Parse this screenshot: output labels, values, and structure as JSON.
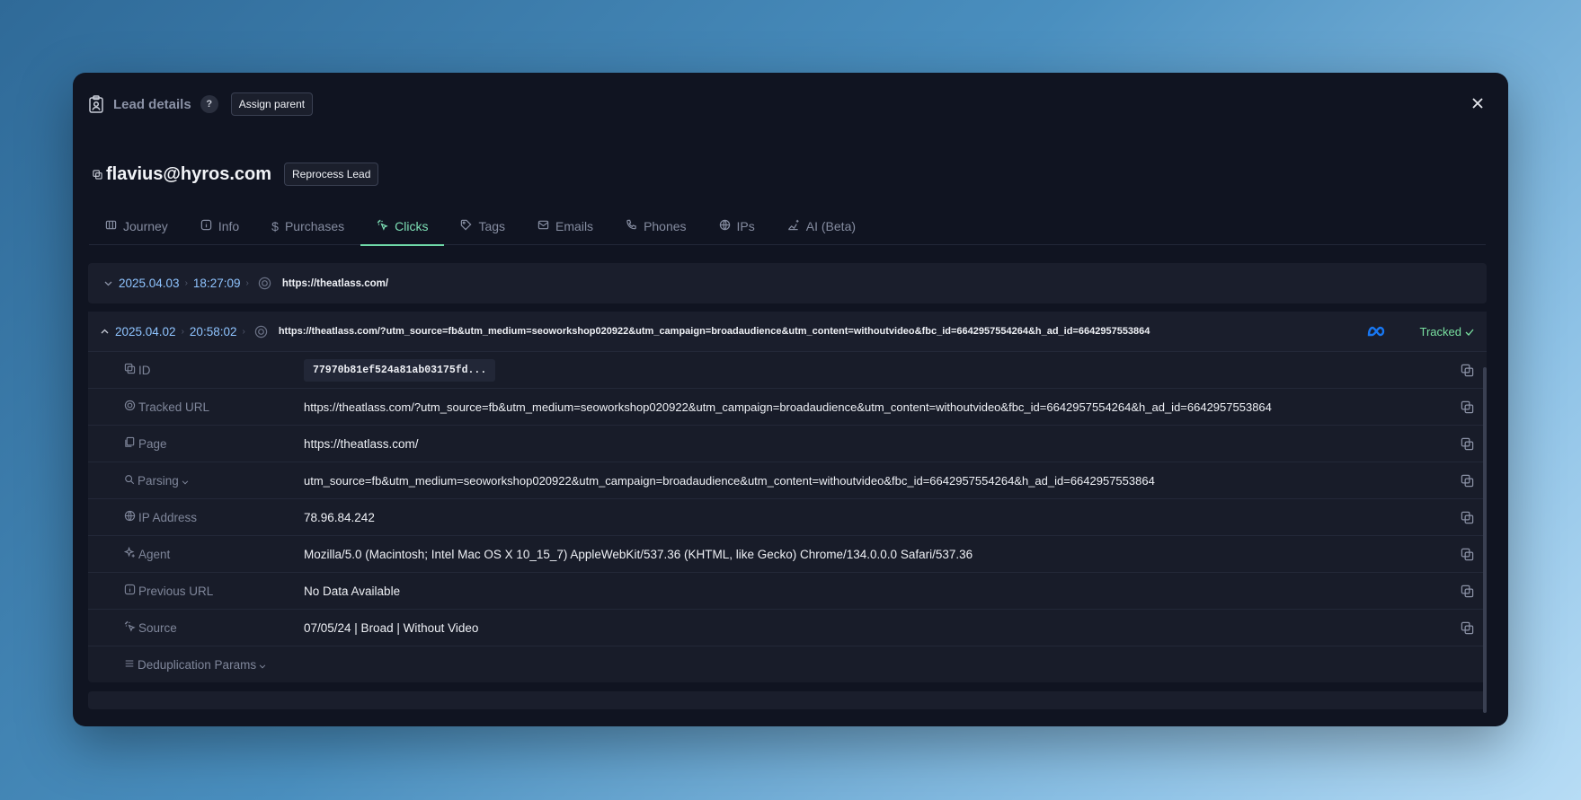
{
  "header": {
    "title": "Lead details",
    "help": "?",
    "assign_label": "Assign parent"
  },
  "lead": {
    "email": "flavius@hyros.com",
    "reprocess_label": "Reprocess Lead"
  },
  "tabs": [
    {
      "label": "Journey",
      "icon": "map-icon"
    },
    {
      "label": "Info",
      "icon": "info-icon"
    },
    {
      "label": "Purchases",
      "icon": "dollar-icon"
    },
    {
      "label": "Clicks",
      "icon": "cursor-click-icon",
      "active": true
    },
    {
      "label": "Tags",
      "icon": "tag-icon"
    },
    {
      "label": "Emails",
      "icon": "mail-icon"
    },
    {
      "label": "Phones",
      "icon": "phone-icon"
    },
    {
      "label": "IPs",
      "icon": "globe-icon"
    },
    {
      "label": "AI (Beta)",
      "icon": "sparkle-chart-icon"
    }
  ],
  "clicks": [
    {
      "date": "2025.04.03",
      "time": "18:27:09",
      "url": "https://theatlass.com/",
      "expanded": false
    },
    {
      "date": "2025.04.02",
      "time": "20:58:02",
      "url": "https://theatlass.com/?utm_source=fb&utm_medium=seoworkshop020922&utm_campaign=broadaudience&utm_content=withoutvideo&fbc_id=6642957554264&h_ad_id=6642957553864",
      "expanded": true,
      "status": "Tracked",
      "platform_icon": "meta-icon",
      "details": {
        "id_label": "ID",
        "id_value": "77970b81ef524a81ab03175fd...",
        "tracked_url_label": "Tracked URL",
        "tracked_url": "https://theatlass.com/?utm_source=fb&utm_medium=seoworkshop020922&utm_campaign=broadaudience&utm_content=withoutvideo&fbc_id=6642957554264&h_ad_id=6642957553864",
        "page_label": "Page",
        "page": "https://theatlass.com/",
        "parsing_label": "Parsing",
        "parsing": "utm_source=fb&utm_medium=seoworkshop020922&utm_campaign=broadaudience&utm_content=withoutvideo&fbc_id=6642957554264&h_ad_id=6642957553864",
        "ip_label": "IP Address",
        "ip": "78.96.84.242",
        "agent_label": "Agent",
        "agent": "Mozilla/5.0 (Macintosh; Intel Mac OS X 10_15_7) AppleWebKit/537.36 (KHTML, like Gecko) Chrome/134.0.0.0 Safari/537.36",
        "prev_label": "Previous URL",
        "prev": "No Data Available",
        "source_label": "Source",
        "source": "07/05/24 | Broad | Without Video",
        "dedup_label": "Deduplication Params"
      }
    }
  ],
  "colors": {
    "accent": "#6fd9a8",
    "date": "#8fc4ff",
    "tracked": "#79e0a0",
    "meta": "#1877f2"
  }
}
